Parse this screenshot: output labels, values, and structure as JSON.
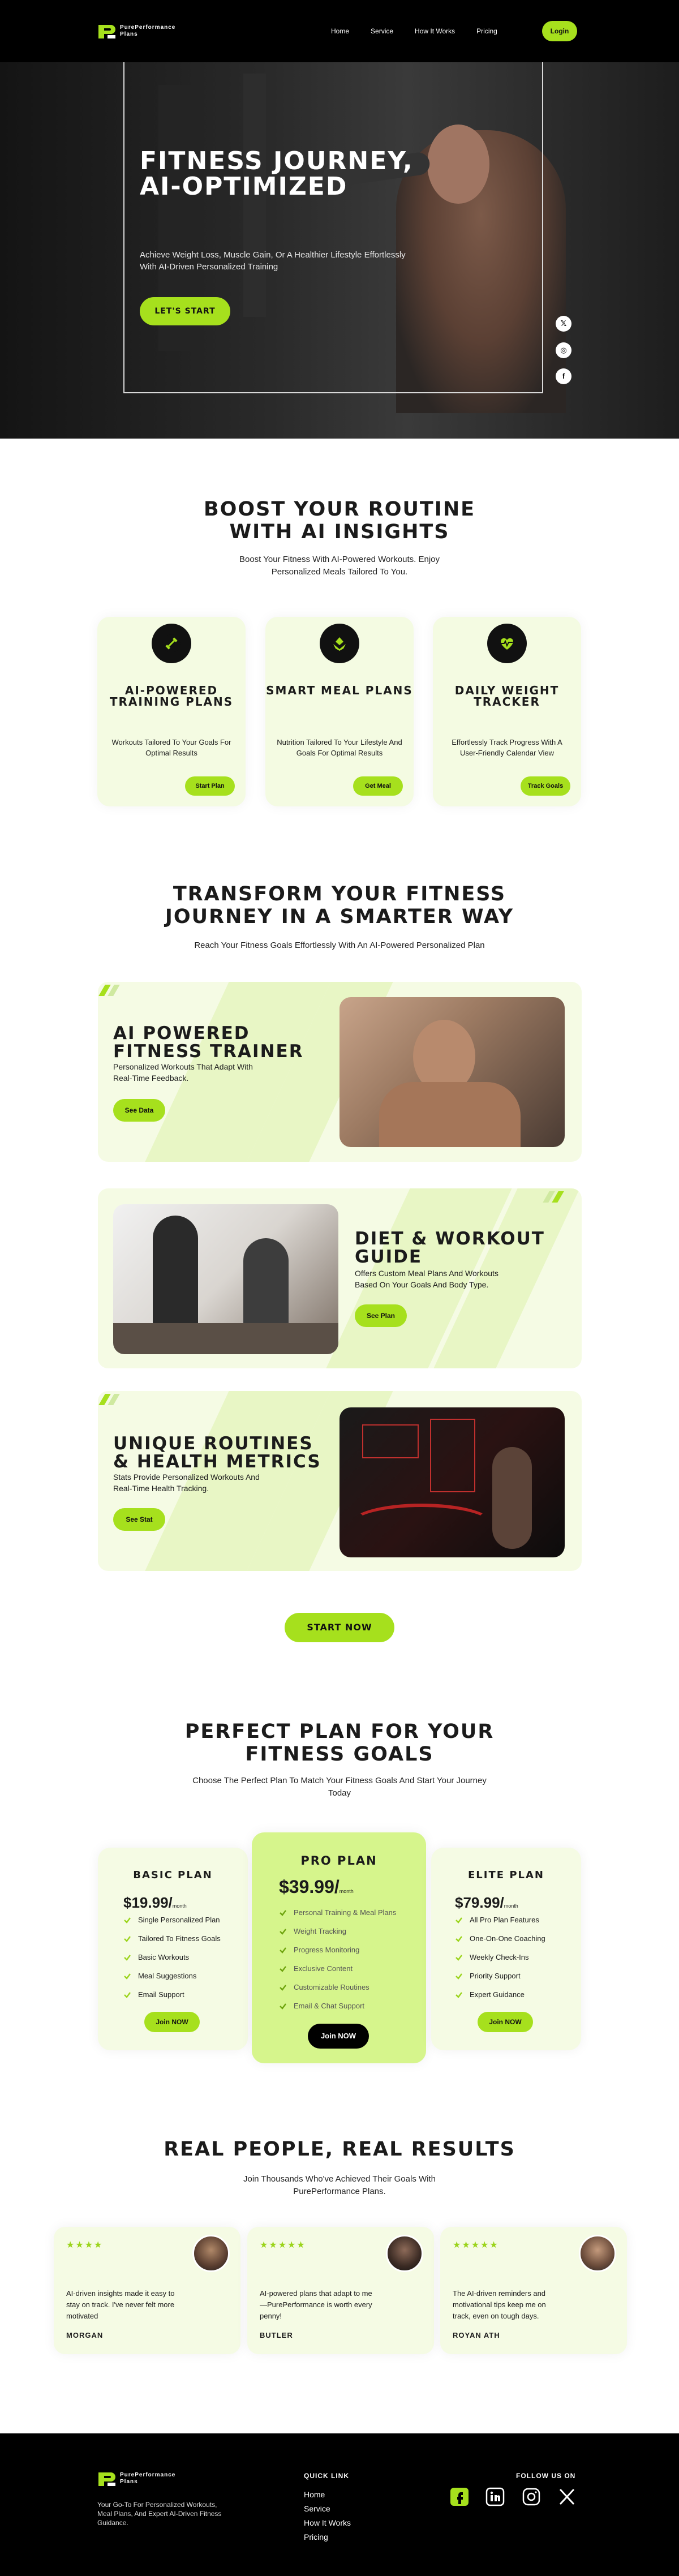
{
  "brand": {
    "name_line1": "PurePerformance",
    "name_line2": "Plans"
  },
  "nav": {
    "links": [
      "Home",
      "Service",
      "How It Works",
      "Pricing"
    ],
    "login": "Login"
  },
  "hero": {
    "title": "Fitness Journey, AI-Optimized",
    "subtitle": "Achieve Weight Loss, Muscle Gain, Or A Healthier Lifestyle Effortlessly With AI-Driven Personalized Training",
    "cta": "Let's Start",
    "social": [
      "x-icon",
      "instagram-icon",
      "facebook-icon"
    ]
  },
  "boost": {
    "title": "Boost Your Routine With AI Insights",
    "subtitle": "Boost Your Fitness With AI-Powered Workouts. Enjoy Personalized Meals Tailored To You.",
    "cards": [
      {
        "icon": "dumbbell-icon",
        "title": "AI-Powered Training Plans",
        "desc": "Workouts Tailored To Your Goals For Optimal Results",
        "button": "Start Plan"
      },
      {
        "icon": "leaf-icon",
        "title": "Smart Meal Plans",
        "desc": "Nutrition Tailored To Your Lifestyle And Goals For Optimal Results",
        "button": "Get Meal"
      },
      {
        "icon": "heart-pulse-icon",
        "title": "Daily Weight Tracker",
        "desc": "Effortlessly Track Progress With A User-Friendly Calendar View",
        "button": "Track Goals"
      }
    ]
  },
  "transform": {
    "title": "Transform Your Fitness Journey In A Smarter Way",
    "subtitle": "Reach Your Fitness Goals Effortlessly With An AI-Powered Personalized Plan",
    "rows": [
      {
        "title": "AI Powered Fitness Trainer",
        "desc": "Personalized Workouts That Adapt With Real-Time Feedback.",
        "button": "See Data"
      },
      {
        "title": "Diet & Workout Guide",
        "desc": "Offers Custom Meal Plans And Workouts Based On Your Goals And Body Type.",
        "button": "See Plan"
      },
      {
        "title": "Unique Routines & Health Metrics",
        "desc": "Stats Provide Personalized Workouts And Real-Time Health Tracking.",
        "button": "See Stat"
      }
    ],
    "cta": "Start Now"
  },
  "pricing": {
    "title": "Perfect Plan For Your Fitness Goals",
    "subtitle": "Choose The Perfect Plan To Match Your Fitness Goals And Start Your Journey Today",
    "plans": [
      {
        "name": "Basic Plan",
        "price": "$19.99/",
        "period": "month",
        "features": [
          "Single Personalized Plan",
          "Tailored To Fitness Goals",
          "Basic Workouts",
          "Meal Suggestions",
          "Email Support"
        ],
        "button": "Join NOW"
      },
      {
        "name": "Pro Plan",
        "price": "$39.99/",
        "period": "month",
        "features": [
          "Personal Training & Meal Plans",
          "Weight Tracking",
          "Progress Monitoring",
          "Exclusive Content",
          "Customizable Routines",
          "Email & Chat Support"
        ],
        "button": "Join NOW"
      },
      {
        "name": "Elite Plan",
        "price": "$79.99/",
        "period": "month",
        "features": [
          "All Pro Plan Features",
          "One-On-One Coaching",
          "Weekly Check-Ins",
          "Priority Support",
          "Expert Guidance"
        ],
        "button": "Join NOW"
      }
    ]
  },
  "testimonials": {
    "title": "Real People, Real Results",
    "subtitle": "Join Thousands Who've Achieved Their Goals With PurePerformance Plans.",
    "items": [
      {
        "stars": "★★★★",
        "text": "AI-driven insights made it easy to stay on track. I've never felt more motivated",
        "name": "MORGAN"
      },
      {
        "stars": "★★★★★",
        "text": "AI-powered plans that adapt to me—PurePerformance is worth every penny!",
        "name": "BUTLER"
      },
      {
        "stars": "★★★★★",
        "text": "The AI-driven reminders and motivational tips keep me on track, even on tough days.",
        "name": "ROYAN ATH"
      }
    ]
  },
  "footer": {
    "tagline": "Your Go-To For Personalized Workouts, Meal Plans, And Expert AI-Driven Fitness Guidance.",
    "quick_link_title": "QUICK LINK",
    "links": [
      "Home",
      "Service",
      "How It Works",
      "Pricing"
    ],
    "follow_title": "FOLLOW US ON",
    "social": [
      "facebook-icon",
      "linkedin-icon",
      "instagram-icon",
      "x-icon"
    ]
  },
  "colors": {
    "accent": "#a6e01d",
    "card_bg": "#f5fbe4",
    "dark": "#000000"
  }
}
